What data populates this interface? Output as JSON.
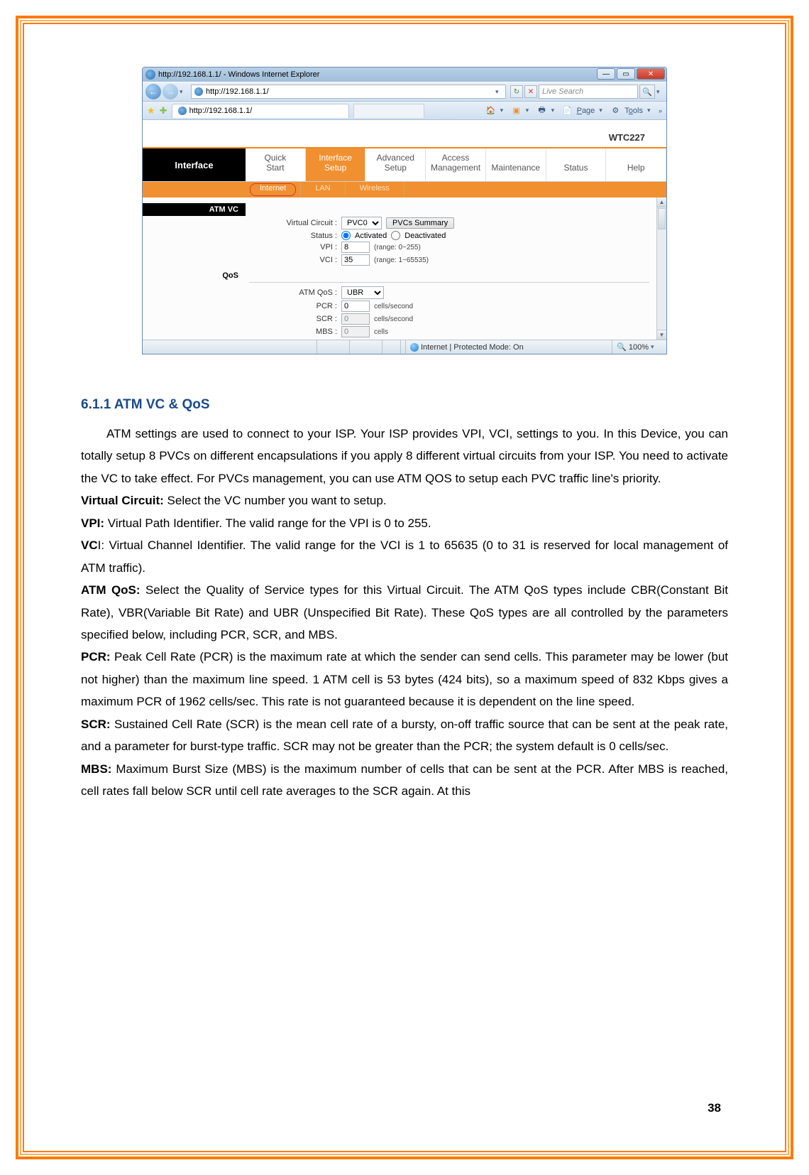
{
  "browser": {
    "title": "http://192.168.1.1/ - Windows Internet Explorer",
    "url": "http://192.168.1.1/",
    "search_placeholder": "Live Search",
    "tab_title": "http://192.168.1.1/",
    "tools": {
      "page": "Page",
      "tools": "Tools"
    },
    "statusbar": {
      "mode": "Internet | Protected Mode: On",
      "zoom": "100%"
    }
  },
  "router": {
    "model": "WTC227",
    "side_label": "Interface",
    "main_tabs": [
      "Quick Start",
      "Interface Setup",
      "Advanced Setup",
      "Access Management",
      "Maintenance",
      "Status",
      "Help"
    ],
    "main_active_index": 1,
    "sub_tabs": [
      "Internet",
      "LAN",
      "Wireless"
    ],
    "sub_active_index": 0,
    "sections": {
      "atm": {
        "title": "ATM VC",
        "virtual_circuit_label": "Virtual Circuit :",
        "virtual_circuit_value": "PVC0",
        "pvcs_button": "PVCs Summary",
        "status_label": "Status :",
        "status_options": [
          "Activated",
          "Deactivated"
        ],
        "status_selected": 0,
        "vpi_label": "VPI :",
        "vpi_value": "8",
        "vpi_hint": "(range: 0~255)",
        "vci_label": "VCI :",
        "vci_value": "35",
        "vci_hint": "(range: 1~65535)"
      },
      "qos": {
        "title": "QoS",
        "atmqos_label": "ATM QoS :",
        "atmqos_value": "UBR",
        "pcr_label": "PCR :",
        "pcr_value": "0",
        "pcr_hint": "cells/second",
        "scr_label": "SCR :",
        "scr_value": "0",
        "scr_hint": "cells/second",
        "mbs_label": "MBS :",
        "mbs_value": "0",
        "mbs_hint": "cells"
      }
    }
  },
  "doc": {
    "heading": "6.1.1 ATM VC & QoS",
    "p1": "ATM settings are used to connect to your ISP. Your ISP provides VPI, VCI, settings to you. In this Device, you can totally setup 8 PVCs on different encapsulations if you apply 8 different virtual circuits from your ISP. You need to activate the VC to take effect. For PVCs management, you can use ATM QOS to setup each PVC traffic line's priority.",
    "vc_bold": "Virtual Circuit:",
    "vc_text": " Select the VC number you want to setup.",
    "vpi_bold": "VPI:",
    "vpi_text": " Virtual Path Identifier. The valid range for the VPI is 0 to 255.",
    "vci_bold": "VC",
    "vci_rest": "I: Virtual Channel Identifier. The valid range for the VCI is 1 to 65635 (0 to 31 is reserved for local management of ATM traffic).",
    "atmqos_bold": "ATM QoS:",
    "atmqos_text": " Select the Quality of Service types for this Virtual Circuit. The ATM QoS types include CBR(Constant Bit Rate), VBR(Variable Bit Rate) and UBR (Unspecified Bit Rate). These QoS types are all controlled by the parameters specified below, including PCR, SCR, and MBS.",
    "pcr_bold": "PCR:",
    "pcr_text": " Peak Cell Rate (PCR) is the maximum rate at which the sender can send cells. This parameter may be lower (but not higher) than the maximum line speed. 1 ATM cell is 53 bytes (424 bits), so a maximum speed of 832 Kbps gives a maximum PCR of 1962 cells/sec. This rate is not guaranteed because it is dependent on the line speed.",
    "scr_bold": "SCR:",
    "scr_text": " Sustained Cell Rate (SCR) is the mean cell rate of a bursty, on-off traffic source that can be sent at the peak rate, and a parameter for burst-type traffic. SCR may not be greater than the PCR; the system default is 0 cells/sec.",
    "mbs_bold": "MBS:",
    "mbs_text": " Maximum Burst Size (MBS) is the maximum number of cells that can be sent at the PCR. After MBS is reached, cell rates fall below SCR until cell rate averages to the SCR again. At this",
    "page_number": "38"
  }
}
